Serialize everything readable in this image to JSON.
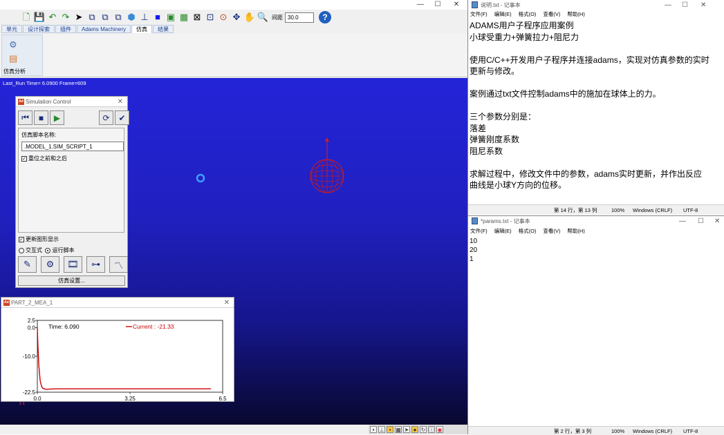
{
  "adams": {
    "window_controls": {
      "minimize": "—",
      "maximize": "☐",
      "close": "✕"
    },
    "toolbar": {
      "icons": [
        "new-icon",
        "save-icon",
        "undo-icon",
        "redo-icon",
        "select-arrow-icon",
        "view-front-icon",
        "view-side-icon",
        "view-top-icon",
        "view-iso-icon",
        "axes-icon",
        "render-icon",
        "image-icon",
        "grid-icon",
        "mesh-icon",
        "target-icon",
        "marker-icon",
        "move-icon",
        "pan-icon",
        "zoom-icon"
      ],
      "zoom_label": "间距",
      "zoom_value": "30.0",
      "help_glyph": "?"
    },
    "ribbon_tabs": [
      {
        "label": "单元",
        "active": false
      },
      {
        "label": "设计探索",
        "active": false
      },
      {
        "label": "插件",
        "active": false
      },
      {
        "label": "Adams Machinery",
        "active": false
      },
      {
        "label": "仿真",
        "active": true
      },
      {
        "label": "结果",
        "active": false
      }
    ],
    "ribbon_group_label": "仿真分析",
    "viewport_status": "Last_Run   Time= 6.0900  Frame=609",
    "sim_control": {
      "title": "Simulation Control",
      "logo": "Ad",
      "close": "✕",
      "script_name_label": "仿真脚本名称:",
      "script_name_value": ".MODEL_1.SIM_SCRIPT_1",
      "reset_check_label": "重位之前和之后",
      "update_graphics_label": "更新图形显示",
      "radio_interactive": "交互式",
      "radio_script": "运行脚本",
      "settings_button": "仿真设置..."
    },
    "plot": {
      "title": "PART_2_MEA_1",
      "logo": "Ad",
      "close": "✕",
      "time_label": "Time:  6.090",
      "current_label": "Current :  -21.33",
      "triad": "z  x"
    }
  },
  "chart_data": {
    "type": "line",
    "title": "PART_2_MEA_1",
    "xlabel": "",
    "ylabel": "",
    "xlim": [
      0.0,
      6.5
    ],
    "ylim": [
      -22.5,
      2.5
    ],
    "x_ticks": [
      "0.0",
      "3.25",
      "6.5"
    ],
    "y_ticks": [
      "2.5",
      "0.0",
      "-10.0",
      "-22.5"
    ],
    "series": [
      {
        "name": "Current",
        "color": "#cc0000",
        "x": [
          0.0,
          0.02,
          0.05,
          0.1,
          0.15,
          0.2,
          0.3,
          0.45,
          0.6,
          1.0,
          2.0,
          3.0,
          4.0,
          5.0,
          6.09
        ],
        "y": [
          0.0,
          -6.0,
          -13.0,
          -18.5,
          -20.5,
          -21.2,
          -21.5,
          -21.4,
          -21.35,
          -21.33,
          -21.33,
          -21.33,
          -21.33,
          -21.33,
          -21.33
        ]
      }
    ],
    "grid": false
  },
  "notepad1": {
    "title": "说明.txt - 记事本",
    "menu": [
      "文件(F)",
      "编辑(E)",
      "格式(O)",
      "查看(V)",
      "帮助(H)"
    ],
    "lines": [
      "ADAMS用户子程序应用案例",
      "小球受重力+弹簧拉力+阻尼力",
      "",
      "使用C/C++开发用户子程序并连接adams，实现对仿真参数的实时",
      "更新与修改。",
      "",
      "案例通过txt文件控制adams中的施加在球体上的力。",
      "",
      "三个参数分别是：",
      "落差",
      "弹簧刚度系数",
      "阻尼系数",
      "",
      "求解过程中，修改文件中的参数，adams实时更新，并作出反应",
      "曲线是小球Y方向的位移。"
    ],
    "status": {
      "position": "第 14 行，第 13 列",
      "zoom": "100%",
      "eol": "Windows (CRLF)",
      "encoding": "UTF-8"
    }
  },
  "notepad2": {
    "title": "*params.txt - 记事本",
    "menu": [
      "文件(F)",
      "编辑(E)",
      "格式(O)",
      "查看(V)",
      "帮助(H)"
    ],
    "lines": [
      "10",
      "20",
      "1"
    ],
    "status": {
      "position": "第 2 行，第 3 列",
      "zoom": "100%",
      "eol": "Windows (CRLF)",
      "encoding": "UTF-8"
    }
  },
  "colors": {
    "viewport": "#2020c0",
    "ball": "#cc1a1a",
    "curve": "#cc0000",
    "accent": "#1e3f8f"
  }
}
